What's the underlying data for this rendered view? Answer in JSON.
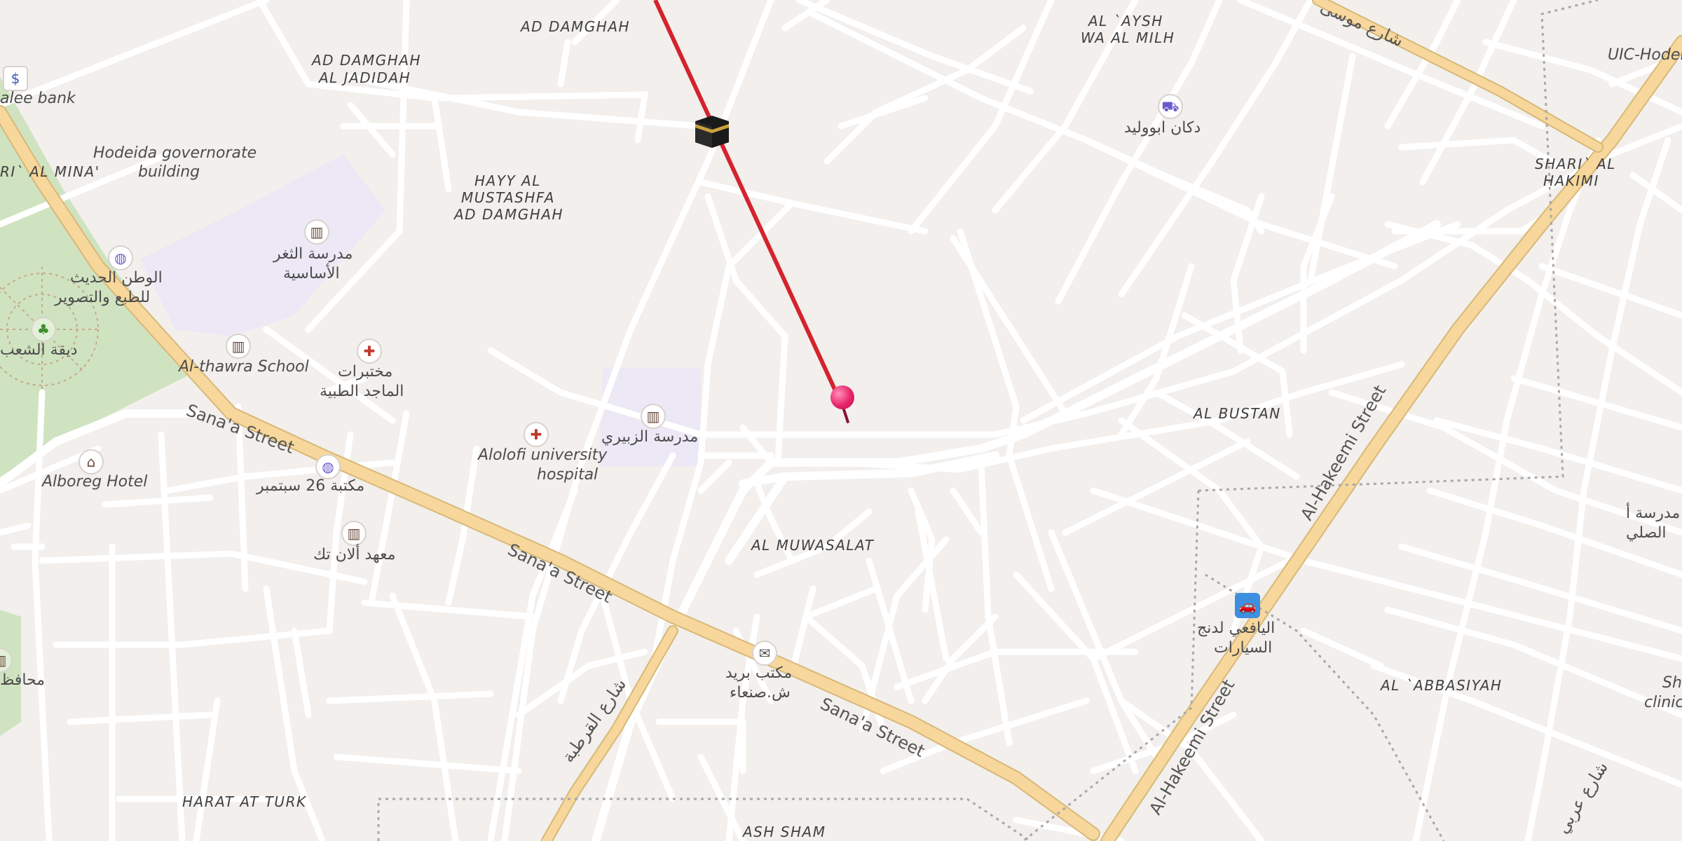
{
  "map": {
    "districts": {
      "ad_damghah": "AD DAMGHAH",
      "ad_damghah_jadidah_1": "AD DAMGHAH",
      "ad_damghah_jadidah_2": "AL JADIDAH",
      "al_aysh_1": "AL `AYSH",
      "al_aysh_2": "WA AL MILH",
      "hayy_1": "HAYY AL",
      "hayy_2": "MUSTASHFA",
      "hayy_3": "AD DAMGHAH",
      "al_bustan": "AL BUSTAN",
      "al_muwasalat": "AL MUWASALAT",
      "al_abbasiyah": "AL `ABBASIYAH",
      "harat_at_turk": "HARAT AT TURK",
      "ash_sham": "ASH SHAM",
      "shari_al_mina": "RI` AL MINA'",
      "shari_al_hakimi_1": "SHARI` AL",
      "shari_al_hakimi_2": "HAKIMI"
    },
    "pois": {
      "bank": "alee bank",
      "governorate_1": "Hodeida governorate",
      "governorate_2": "building",
      "school_thaghr_1": "مدرسة الثغر",
      "school_thaghr_2": "الأساسية",
      "print_1": "الوطن الحديث",
      "print_2": "للطبع والتصوير",
      "park": "ديقة الشعب",
      "thawra_school": "Al-thawra School",
      "labs_1": "مختبرات",
      "labs_2": "الماجد الطبية",
      "zubairi_school": "مدرسة الزبيري",
      "alolofi_1": "Alolofi university",
      "alolofi_2": "hospital",
      "hotel": "Alboreg Hotel",
      "library": "مكتبة 26 سبتمبر",
      "institute": "معهد ألان تك",
      "post_1": "مكتب بريد",
      "post_2": "ش.صنعاء",
      "shop": "دكان ابووليد",
      "uic": "UIC-Hodei",
      "car_1": "اليافعي لدنج",
      "car_2": "السيارات",
      "school_right_1": "مدرسة أ",
      "school_right_2": "الصلي",
      "clinic_1": "Sh",
      "clinic_2": "clinic",
      "governor": "محافظ"
    },
    "streets": {
      "sanaa_1": "Sana'a Street",
      "sanaa_2": "Sana'a Street",
      "sanaa_3": "Sana'a Street",
      "hakeemi_1": "Al-Hakeemi Street",
      "hakeemi_2": "Al-Hakeemi Street",
      "qurtuba": "شارع القرطبة",
      "top_ar": "شارع موسى",
      "right_ar": "شارع عربي"
    },
    "icons": {
      "bank": "bank-icon",
      "shopping": "shopping-bag-icon",
      "school": "school-icon",
      "hospital": "hospital-icon",
      "hotel": "bed-icon",
      "post": "mail-icon",
      "cart": "cart-icon",
      "car": "car-icon",
      "park": "tree-icon",
      "kaaba": "kaaba-icon",
      "pin": "location-pin-icon"
    },
    "colors": {
      "background": "#f2efec",
      "road": "#ffffff",
      "primary_road": "#f7d79b",
      "park": "#cfe3c0",
      "school_area": "#ece8f6",
      "qibla_line": "#d4232d",
      "pin": "#e8236a"
    }
  }
}
